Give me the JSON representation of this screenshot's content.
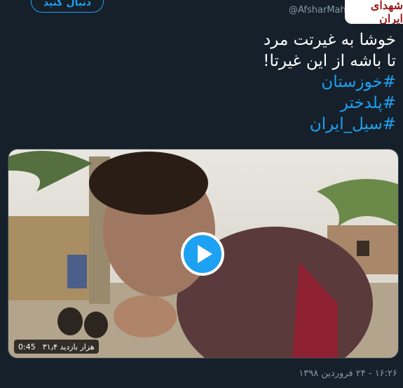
{
  "header": {
    "follow_label": "دنبال کنید",
    "handle": "@AfsharMah",
    "logo_text": "شهدای ایران"
  },
  "tweet": {
    "lines": [
      "خوشا به غیرتت مرد",
      "تا باشه از این غیرتا!"
    ],
    "hashtags": [
      "#خوزستان",
      "#پلدختر",
      "#سیل_ایران"
    ]
  },
  "media": {
    "duration": "0:45",
    "views": "۳۱٫۴ هزار بازدید",
    "play_icon": "play-icon"
  },
  "meta": {
    "timestamp": "۱۶:۲۶ - ۲۴ فروردین ۱۳۹۸"
  },
  "colors": {
    "background": "#15202b",
    "accent": "#1da1f2",
    "muted": "#8899a6"
  }
}
